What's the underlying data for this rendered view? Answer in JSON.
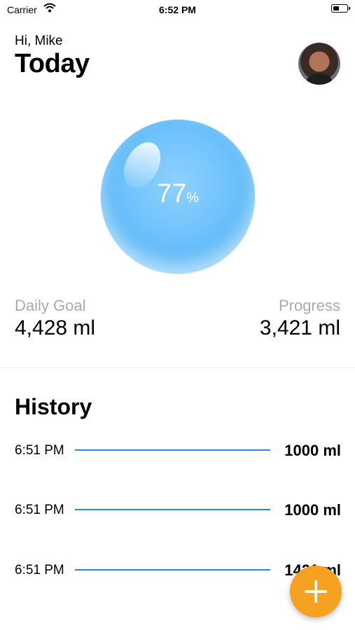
{
  "status_bar": {
    "carrier": "Carrier",
    "time": "6:52 PM",
    "icons": [
      "wifi-icon",
      "battery-icon"
    ]
  },
  "header": {
    "greeting": "Hi, Mike",
    "title": "Today",
    "avatar": "profile-photo"
  },
  "progress": {
    "percent_value": "77",
    "percent_symbol": "%",
    "fill_fraction": 0.77
  },
  "stats": {
    "daily_goal_label": "Daily Goal",
    "daily_goal_value": "4,428 ml",
    "progress_label": "Progress",
    "progress_value": "3,421 ml"
  },
  "history": {
    "title": "History",
    "entries": [
      {
        "time": "6:51 PM",
        "amount": "1000 ml"
      },
      {
        "time": "6:51 PM",
        "amount": "1000 ml"
      },
      {
        "time": "6:51 PM",
        "amount": "1421 ml"
      }
    ]
  },
  "fab": {
    "icon": "plus-icon"
  },
  "colors": {
    "accent": "#f7a123",
    "line": "#2b86e3",
    "bubble": "#6fc2fb",
    "muted": "#a9a9ae"
  }
}
